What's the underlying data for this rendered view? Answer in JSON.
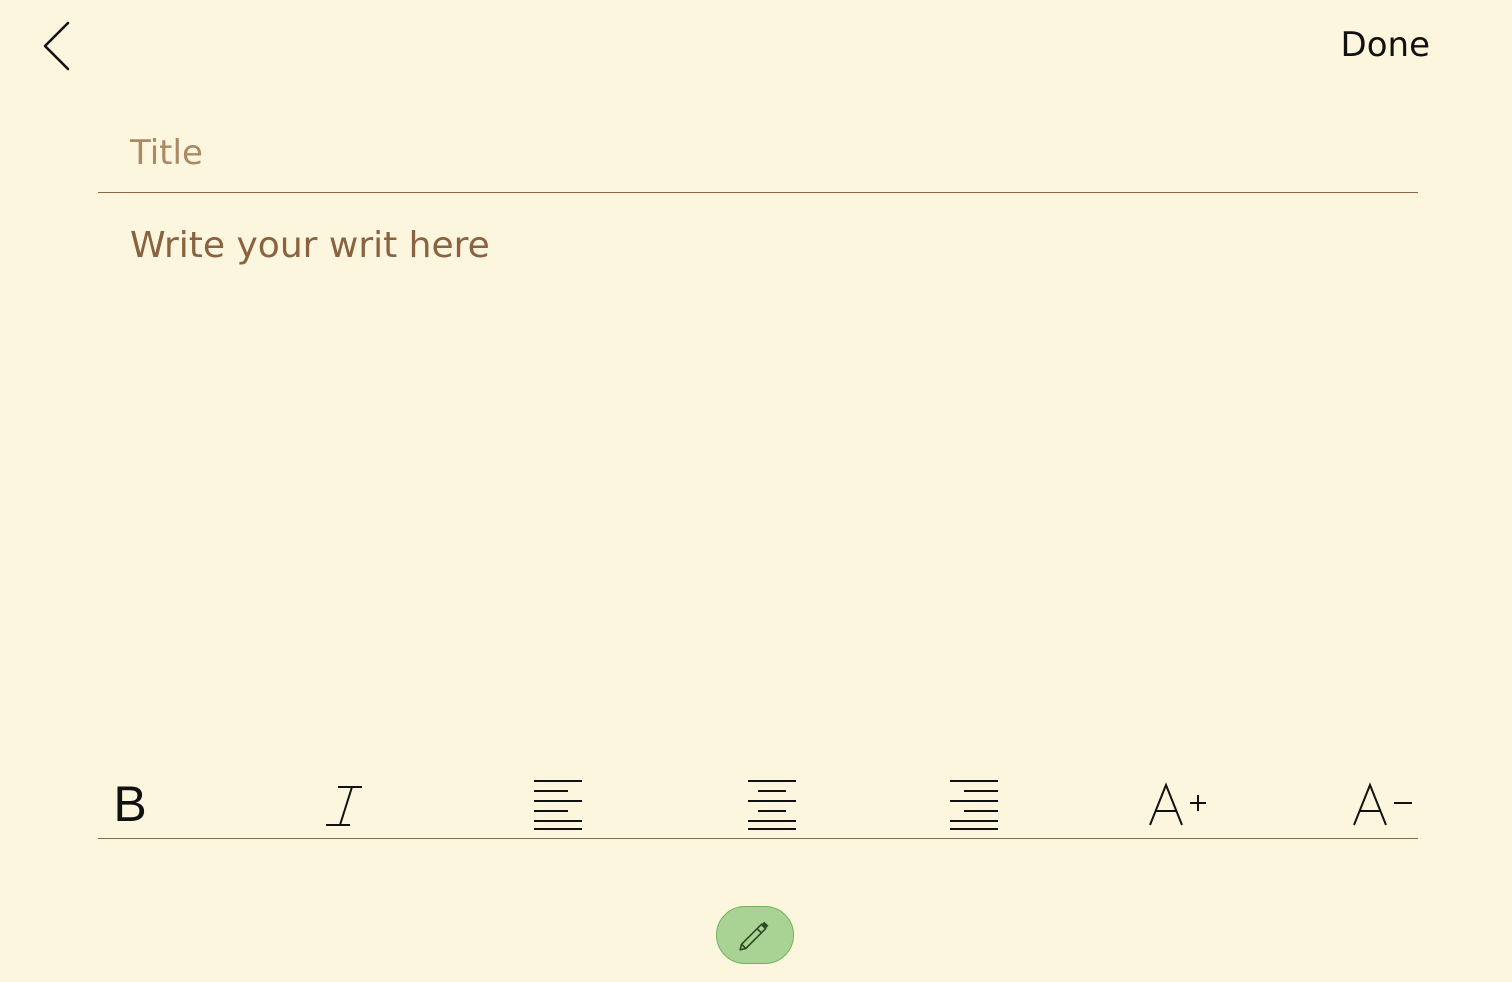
{
  "header": {
    "back_icon": "chevron-left-icon",
    "done_label": "Done"
  },
  "editor": {
    "title_placeholder": "Title",
    "body_placeholder": "Write your writ here"
  },
  "toolbar": {
    "bold_label": "B",
    "items": [
      {
        "name": "bold",
        "icon": "bold-icon"
      },
      {
        "name": "italic",
        "icon": "italic-icon"
      },
      {
        "name": "align-left",
        "icon": "align-left-icon"
      },
      {
        "name": "align-center",
        "icon": "align-center-icon"
      },
      {
        "name": "align-right",
        "icon": "align-right-icon"
      },
      {
        "name": "font-increase",
        "icon": "font-increase-icon"
      },
      {
        "name": "font-decrease",
        "icon": "font-decrease-icon"
      }
    ]
  },
  "fab": {
    "icon": "pencil-icon"
  },
  "colors": {
    "background": "#fdf6de",
    "divider": "#8a6a43",
    "placeholder_title": "#a98a63",
    "placeholder_body": "#8a6240",
    "fab_fill": "#a9d394"
  }
}
